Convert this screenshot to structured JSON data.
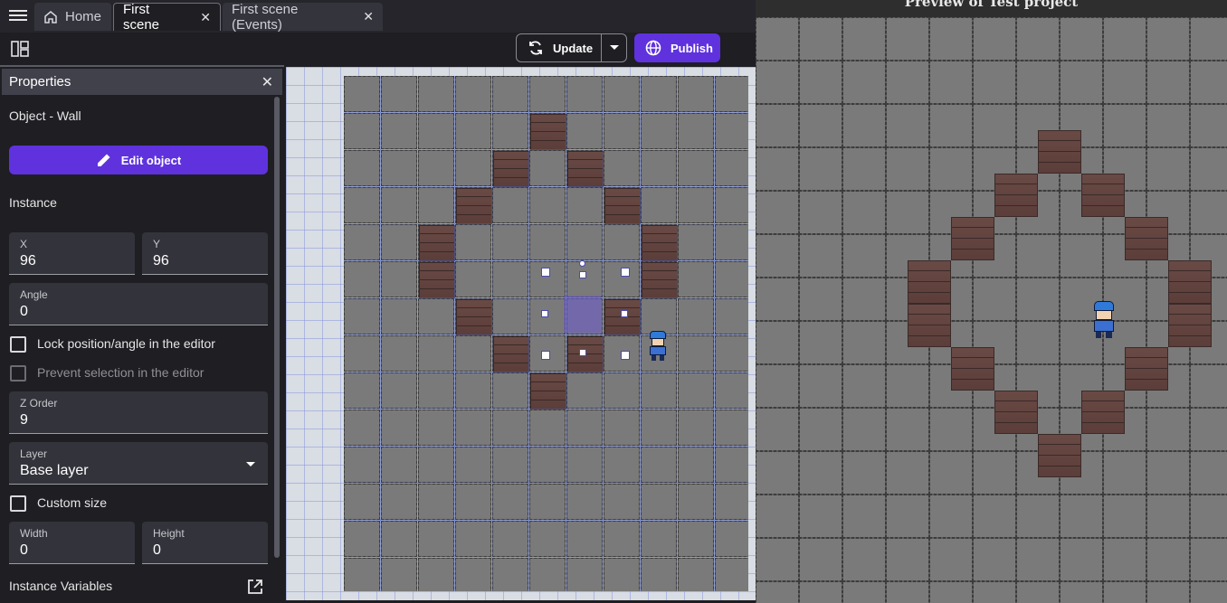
{
  "tabs": [
    {
      "label": "Home"
    },
    {
      "label": "First scene"
    },
    {
      "label": "First scene (Events)"
    }
  ],
  "toolbar": {
    "update_label": "Update",
    "publish_label": "Publish"
  },
  "properties": {
    "title": "Properties",
    "object_line": "Object  - Wall",
    "edit_object_label": "Edit object",
    "instance_heading": "Instance",
    "x_label": "X",
    "x_value": "96",
    "y_label": "Y",
    "y_value": "96",
    "angle_label": "Angle",
    "angle_value": "0",
    "lock_label": "Lock position/angle in the editor",
    "prevent_label": "Prevent selection in the editor",
    "zorder_label": "Z Order",
    "zorder_value": "9",
    "layer_label": "Layer",
    "layer_value": "Base layer",
    "custom_size_label": "Custom size",
    "width_label": "Width",
    "width_value": "0",
    "height_label": "Height",
    "height_value": "0",
    "instance_variables_label": "Instance Variables"
  },
  "preview": {
    "title": "Preview of Test project"
  },
  "icons": {
    "menu": "hamburger-menu-icon",
    "home": "home-icon",
    "layout": "panels-layout-icon",
    "update": "refresh-icon",
    "publish": "globe-icon",
    "edit": "pencil-icon",
    "open": "open-external-icon"
  },
  "colors": {
    "accent": "#5f32de",
    "panel_bg": "#1e1e23",
    "field_bg": "#33333b"
  }
}
